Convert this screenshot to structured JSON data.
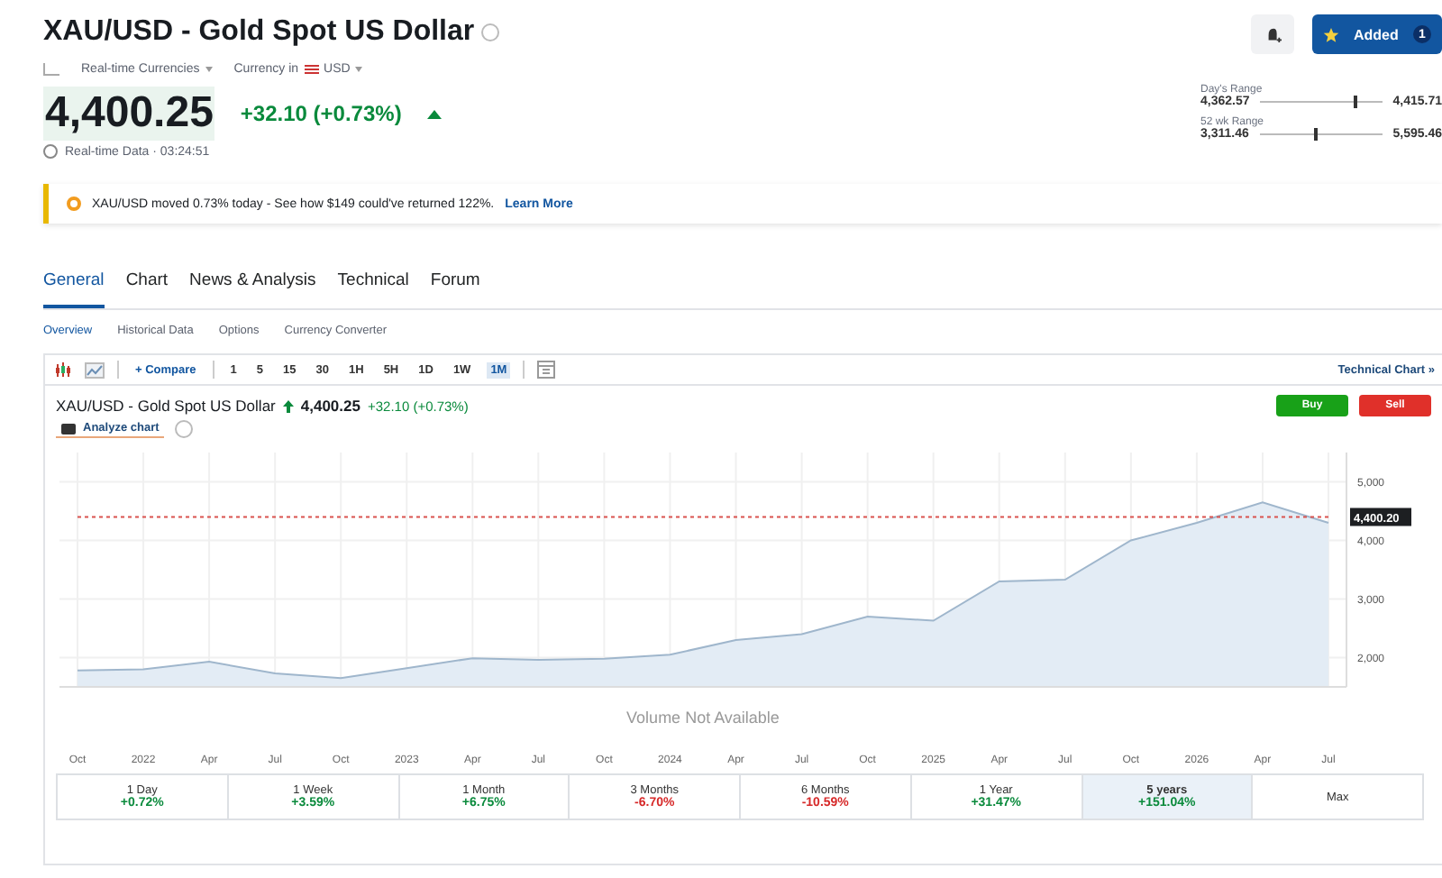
{
  "header": {
    "title": "XAU/USD - Gold Spot US Dollar",
    "meta": [
      {
        "label": "Real-time Currencies"
      },
      {
        "label": "Currency in",
        "value": "USD"
      }
    ],
    "price": "4,400.25",
    "change": "+32.10 (+0.73%)",
    "time": "Real-time Data · 03:24:51"
  },
  "actions": {
    "watch_label": "Added",
    "watch_count": "1"
  },
  "ranges": [
    {
      "label": "Day's Range",
      "low": "4,362.57",
      "high": "4,415.71",
      "level": 0.77
    },
    {
      "label": "52 wk Range",
      "low": "3,311.46",
      "high": "5,595.46",
      "level": 0.45
    }
  ],
  "banner": {
    "text": "XAU/USD moved 0.73% today - See how $149 could've returned 122%.",
    "link": "Learn More"
  },
  "tabs": [
    {
      "label": "General",
      "selected": true
    },
    {
      "label": "Chart",
      "selected": false
    },
    {
      "label": "News & Analysis",
      "selected": false
    },
    {
      "label": "Technical",
      "selected": false
    },
    {
      "label": "Forum",
      "selected": false
    }
  ],
  "subtabs": [
    {
      "label": "Overview",
      "selected": true
    },
    {
      "label": "Historical Data",
      "selected": false
    },
    {
      "label": "Options",
      "selected": false
    },
    {
      "label": "Currency Converter",
      "selected": false
    }
  ],
  "toolbar": {
    "compare": "+ Compare",
    "intervals": [
      {
        "label": "1",
        "selected": false
      },
      {
        "label": "5",
        "selected": false
      },
      {
        "label": "15",
        "selected": false
      },
      {
        "label": "30",
        "selected": false
      },
      {
        "label": "1H",
        "selected": false
      },
      {
        "label": "5H",
        "selected": false
      },
      {
        "label": "1D",
        "selected": false
      },
      {
        "label": "1W",
        "selected": false
      },
      {
        "label": "1M",
        "selected": true
      }
    ],
    "technical_link": "Technical Chart »"
  },
  "chart": {
    "title": "XAU/USD - Gold Spot US Dollar",
    "price": "4,400.25",
    "change": "+32.10 (+0.73%)",
    "analyze": "Analyze chart",
    "buy": "Buy",
    "sell": "Sell",
    "volume_note": "Volume Not Available",
    "chart_data": {
      "type": "area",
      "categories": [
        "Oct",
        "2022",
        "Apr",
        "Jul",
        "Oct",
        "2023",
        "Apr",
        "Jul",
        "Oct",
        "2024",
        "Apr",
        "Jul",
        "Oct",
        "2025",
        "Apr",
        "Jul",
        "Oct",
        "2026",
        "Apr",
        "Jul"
      ],
      "series": [
        {
          "color": "#9fb6cc",
          "values": [
            1780,
            1800,
            1930,
            1730,
            1650,
            1820,
            1990,
            1960,
            1980,
            2050,
            2300,
            2400,
            2700,
            2630,
            3300,
            3330,
            4000,
            4300,
            4650,
            4300
          ]
        },
        {
          "type": "line",
          "line_style": "dashed",
          "color": "#d9534f",
          "values": [
            4400,
            4400,
            4400,
            4400,
            4400,
            4400,
            4400,
            4400,
            4400,
            4400,
            4400,
            4400,
            4400,
            4400,
            4400,
            4400,
            4400,
            4400,
            4400,
            4400
          ]
        }
      ],
      "ylim": [
        1500,
        5500
      ],
      "yticks": [
        {
          "value": 2000,
          "label": "2,000"
        },
        {
          "value": 3000,
          "label": "3,000"
        },
        {
          "value": 4000,
          "label": "4,000"
        },
        {
          "value": 5000,
          "label": "5,000"
        }
      ],
      "grid": true
    },
    "last_label": "4,400.20"
  },
  "periods": [
    {
      "label": "1 Day",
      "value": "+0.72%",
      "color": "#0a8a3c",
      "selected": false
    },
    {
      "label": "1 Week",
      "value": "+3.59%",
      "color": "#0a8a3c",
      "selected": false
    },
    {
      "label": "1 Month",
      "value": "+6.75%",
      "color": "#0a8a3c",
      "selected": false
    },
    {
      "label": "3 Months",
      "value": "-6.70%",
      "color": "#d62828",
      "selected": false
    },
    {
      "label": "6 Months",
      "value": "-10.59%",
      "color": "#d62828",
      "selected": false
    },
    {
      "label": "1 Year",
      "value": "+31.47%",
      "color": "#0a8a3c",
      "selected": false
    },
    {
      "label": "5 years",
      "value": "+151.04%",
      "color": "#0a8a3c",
      "selected": true
    },
    {
      "label": "Max",
      "selected": false
    }
  ]
}
